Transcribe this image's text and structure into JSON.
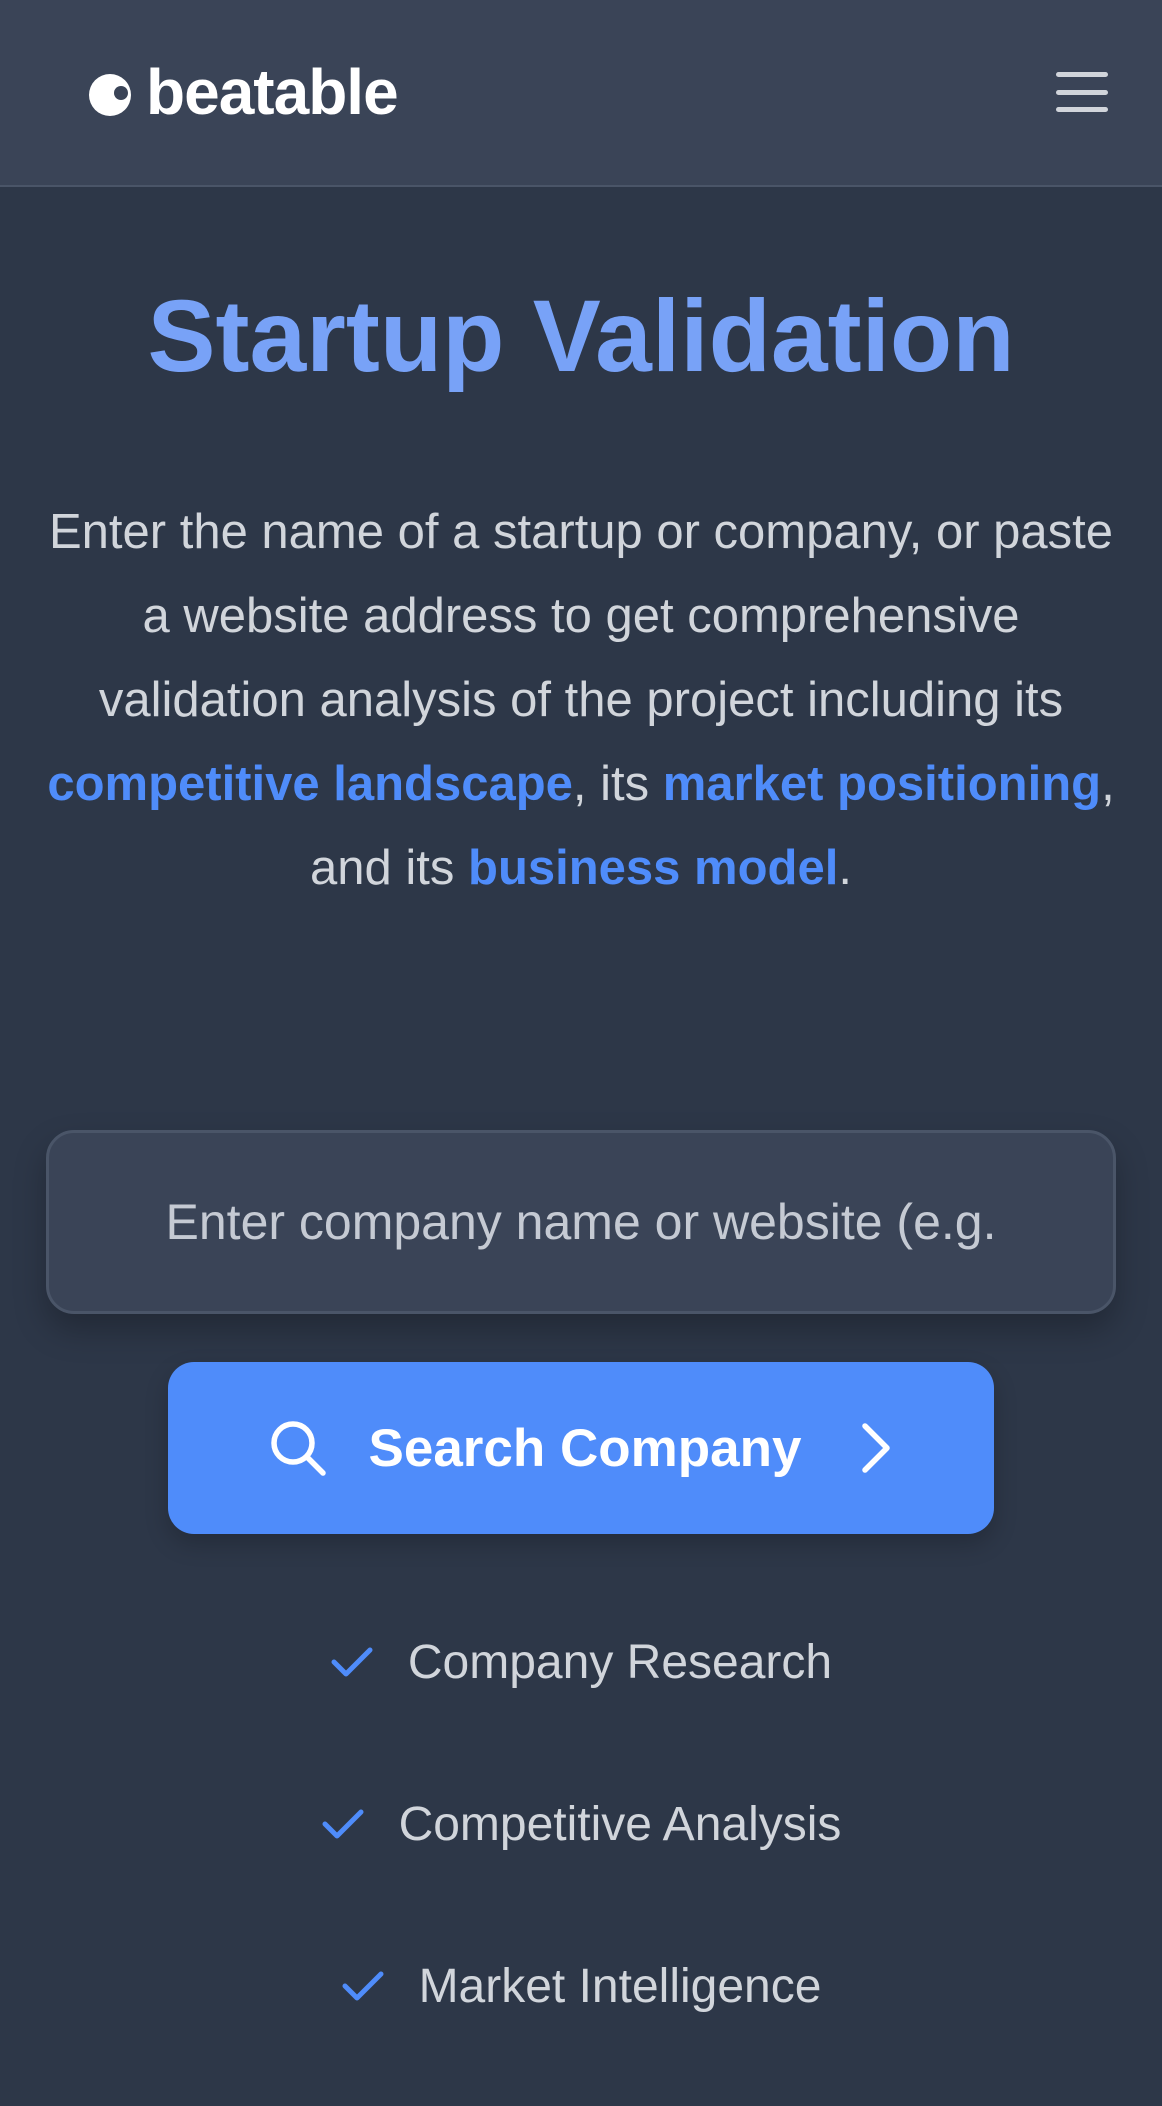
{
  "header": {
    "logo_text": "beatable",
    "logo_icon": "beatable-logo-mark",
    "menu_icon": "hamburger-menu-icon"
  },
  "hero": {
    "title": "Startup Validation",
    "description": {
      "part1": "Enter the name of a startup or company, or paste a website address to get comprehensive validation analysis of the project including its ",
      "highlight1": "competitive landscape",
      "part2": ", its ",
      "highlight2": "market positioning",
      "part3": ", and its ",
      "highlight3": "business model",
      "part4": "."
    }
  },
  "search": {
    "placeholder": "Enter company name or website (e.g.",
    "value": "",
    "button_label": "Search Company",
    "button_icon": "search-icon",
    "button_trailing_icon": "chevron-right-icon"
  },
  "features": [
    {
      "label": "Company Research",
      "icon": "check-icon"
    },
    {
      "label": "Competitive Analysis",
      "icon": "check-icon"
    },
    {
      "label": "Market Intelligence",
      "icon": "check-icon"
    }
  ],
  "colors": {
    "background": "#2d3748",
    "header": "#3a4457",
    "accent": "#4f8cfa",
    "title": "#78a2f7",
    "text": "#d1d5db"
  }
}
